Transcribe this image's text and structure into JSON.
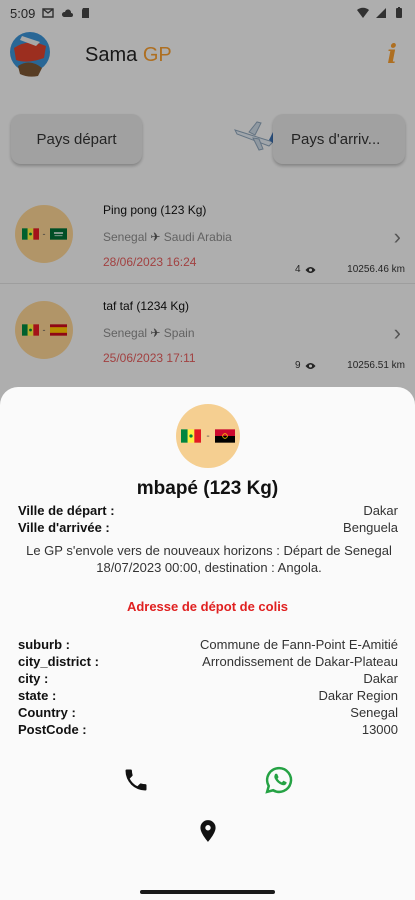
{
  "status_bar": {
    "time": "5:09"
  },
  "app_bar": {
    "title_prefix": "Sama ",
    "title_accent": "GP",
    "info_glyph": "i"
  },
  "filters": {
    "depart_label": "Pays départ",
    "arrivee_label": "Pays d'arriv..."
  },
  "list": [
    {
      "title": "Ping pong  (123 Kg)",
      "origin": "Senegal",
      "destination": "Saudi Arabia",
      "date": "28/06/2023 16:24",
      "views": "4",
      "distance": "10256.46 km"
    },
    {
      "title": "taf taf  (1234 Kg)",
      "origin": "Senegal",
      "destination": "Spain",
      "date": "25/06/2023 17:11",
      "views": "9",
      "distance": "10256.51 km"
    }
  ],
  "detail": {
    "title": "mbapé (123 Kg)",
    "depart_label": "Ville de départ :",
    "depart_value": "Dakar",
    "arrivee_label": "Ville d'arrivée :",
    "arrivee_value": "Benguela",
    "description": "Le GP s'envole vers de nouveaux horizons : Départ de Senegal 18/07/2023 00:00, destination :  Angola.",
    "section_title": "Adresse de dépot de colis",
    "address": [
      {
        "label": "suburb :",
        "value": "Commune de Fann-Point E-Amitié"
      },
      {
        "label": "city_district :",
        "value": "Arrondissement de Dakar-Plateau"
      },
      {
        "label": "city :",
        "value": "Dakar"
      },
      {
        "label": "state :",
        "value": "Dakar Region"
      },
      {
        "label": "Country :",
        "value": "Senegal"
      },
      {
        "label": "PostCode :",
        "value": "13000"
      }
    ]
  },
  "colors": {
    "accent": "#f29a2e",
    "date_red": "#e05a5a",
    "section_red": "#e02020",
    "whatsapp_green": "#25a244",
    "avatar_bg": "#f5cf91"
  },
  "icons": [
    "gmail-icon",
    "cloud-icon",
    "sd-card-icon",
    "wifi-icon",
    "signal-icon",
    "battery-icon",
    "info-icon",
    "plane-icon",
    "chevron-right-icon",
    "eye-icon",
    "phone-icon",
    "whatsapp-icon",
    "location-pin-icon"
  ]
}
